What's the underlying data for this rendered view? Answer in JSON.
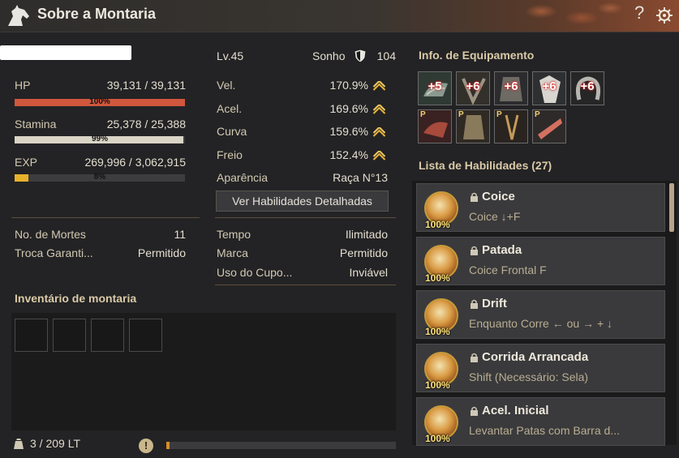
{
  "window": {
    "title": "Sobre a Montaria",
    "help_label": "?"
  },
  "mount": {
    "level": "Lv.45",
    "spirit_label": "Sonho",
    "spirit_value": "104"
  },
  "stats": {
    "hp": {
      "label": "HP",
      "value": "39,131 / 39,131",
      "percent_label": "100%",
      "fraction": 1.0,
      "color": "#d0573d"
    },
    "stamina": {
      "label": "Stamina",
      "value": "25,378 / 25,388",
      "percent_label": "99%",
      "fraction": 0.99,
      "color": "#d9d4c6"
    },
    "exp": {
      "label": "EXP",
      "value": "269,996 / 3,062,915",
      "percent_label": "8%",
      "fraction": 0.08,
      "color": "#e8b22a"
    }
  },
  "movement": [
    {
      "label": "Vel.",
      "value": "170.9%"
    },
    {
      "label": "Acel.",
      "value": "169.6%"
    },
    {
      "label": "Curva",
      "value": "159.6%"
    },
    {
      "label": "Freio",
      "value": "152.4%"
    }
  ],
  "appearance": {
    "label": "Aparência",
    "value": "Raça N°13"
  },
  "detail_button": "Ver Habilidades Detalhadas",
  "info_left": [
    {
      "label": "No. de Mortes",
      "value": "11"
    },
    {
      "label": "Troca Garanti...",
      "value": "Permitido"
    }
  ],
  "info_right": [
    {
      "label": "Tempo",
      "value": "Ilimitado"
    },
    {
      "label": "Marca",
      "value": "Permitido"
    },
    {
      "label": "Uso do Cupo...",
      "value": "Inviável"
    }
  ],
  "inventory": {
    "title": "Inventário de montaria",
    "weight": "3 / 209 LT",
    "weight_fraction": 0.015,
    "warn_glyph": "!"
  },
  "equipment": {
    "title": "Info. de Equipamento",
    "row1": [
      "+5",
      "+6",
      "+6",
      "+6",
      "+6"
    ],
    "row2": [
      "P",
      "P",
      "P",
      "P"
    ]
  },
  "skills": {
    "title": "Lista de Habilidades (27)",
    "items": [
      {
        "name": "Coice",
        "keys": "Coice ↓+F",
        "pct": "100%"
      },
      {
        "name": "Patada",
        "keys": "Coice Frontal F",
        "pct": "100%"
      },
      {
        "name": "Drift",
        "keys": "Enquanto Corre ← ou → + ↓",
        "pct": "100%"
      },
      {
        "name": "Corrida Arrancada",
        "keys": "Shift (Necessário: Sela)",
        "pct": "100%"
      },
      {
        "name": "Acel. Inicial",
        "keys": "Levantar Patas com Barra d...",
        "pct": "100%"
      }
    ]
  }
}
